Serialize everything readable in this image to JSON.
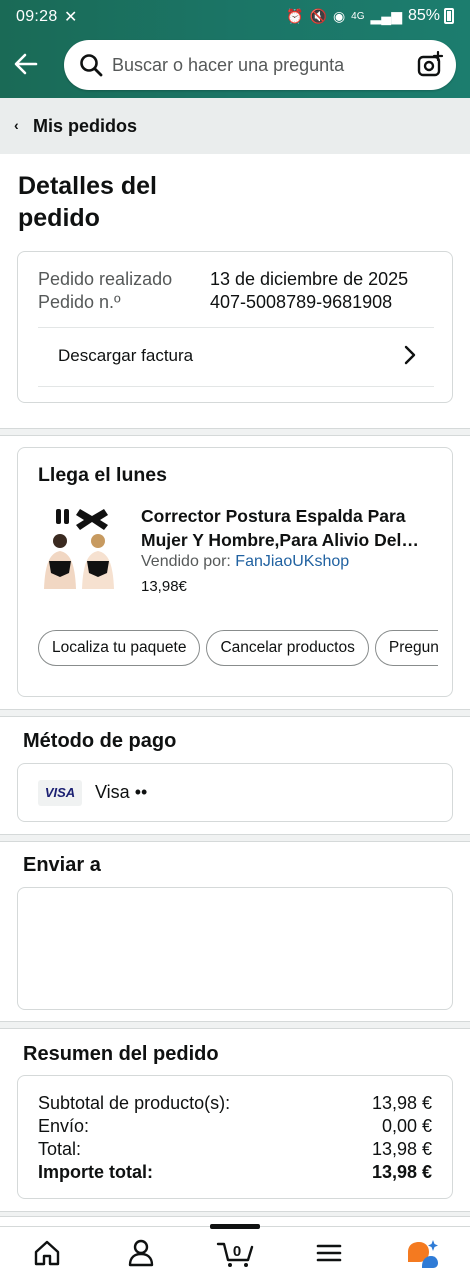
{
  "status_bar": {
    "time": "09:28",
    "network": "4G",
    "battery": "85%"
  },
  "search": {
    "placeholder": "Buscar o hacer una pregunta"
  },
  "breadcrumb": {
    "label": "Mis pedidos"
  },
  "page": {
    "title": "Detalles del pedido"
  },
  "order_info": {
    "placed_label": "Pedido realizado",
    "placed_value": "13 de diciembre de 2025",
    "number_label": "Pedido n.º",
    "number_value": "407-5008789-9681908",
    "invoice_link": "Descargar factura"
  },
  "shipment": {
    "heading": "Llega el lunes",
    "product_title": "Corrector Postura Espalda Para Mujer Y Hombre,Para Alivio Del Dolor",
    "seller_prefix": "Vendido por: ",
    "seller_name": "FanJiaoUKshop",
    "price": "13,98€",
    "actions": [
      "Localiza tu paquete",
      "Cancelar productos",
      "Pregunta al vendedor"
    ]
  },
  "payment": {
    "heading": "Método de pago",
    "card_brand": "VISA",
    "card_text": "Visa ••"
  },
  "shipping": {
    "heading": "Enviar a"
  },
  "summary": {
    "heading": "Resumen del pedido",
    "rows": [
      {
        "label": "Subtotal de producto(s):",
        "value": "13,98 €"
      },
      {
        "label": "Envío:",
        "value": "0,00 €"
      },
      {
        "label": "Total:",
        "value": "13,98 €"
      },
      {
        "label": "Importe total:",
        "value": "13,98 €"
      }
    ]
  },
  "bottom_nav": {
    "cart_count": "0",
    "items": [
      "home-icon",
      "account-icon",
      "cart-icon",
      "menu-icon",
      "rufus-icon"
    ]
  },
  "colors": {
    "header_start": "#1a6a56",
    "header_end": "#1c7d6e",
    "link": "#2162a1",
    "rufus_orange": "#f47a20",
    "rufus_blue": "#2f7bd6"
  }
}
